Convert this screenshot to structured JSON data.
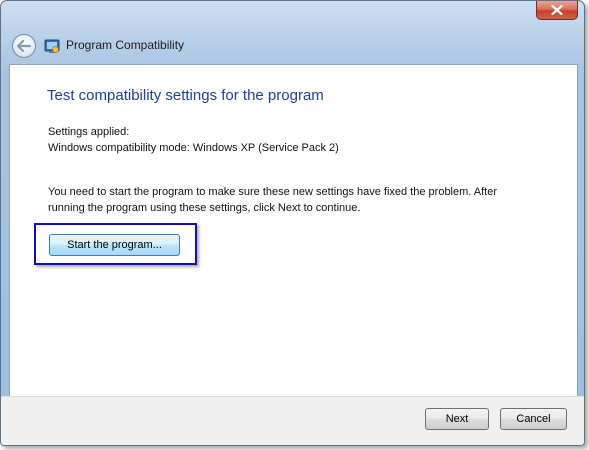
{
  "window": {
    "nav_title": "Program Compatibility"
  },
  "icons": {
    "close": "close-icon",
    "back": "back-arrow-icon",
    "app": "program-compatibility-icon"
  },
  "content": {
    "heading": "Test compatibility settings for the program",
    "settings_label": "Settings applied:",
    "settings_value": "Windows compatibility mode: Windows XP (Service Pack 2)",
    "info_line1": "You need to start the program to make sure these new settings have fixed the problem. After",
    "info_line2": "running the program using these settings, click Next to continue.",
    "start_button": "Start the program..."
  },
  "footer": {
    "next_label": "Next",
    "cancel_label": "Cancel"
  },
  "colors": {
    "heading": "#1e3f9e",
    "highlight_box": "#1010b8",
    "window_frame": "#bcd3ea",
    "close_button": "#c4402a"
  }
}
